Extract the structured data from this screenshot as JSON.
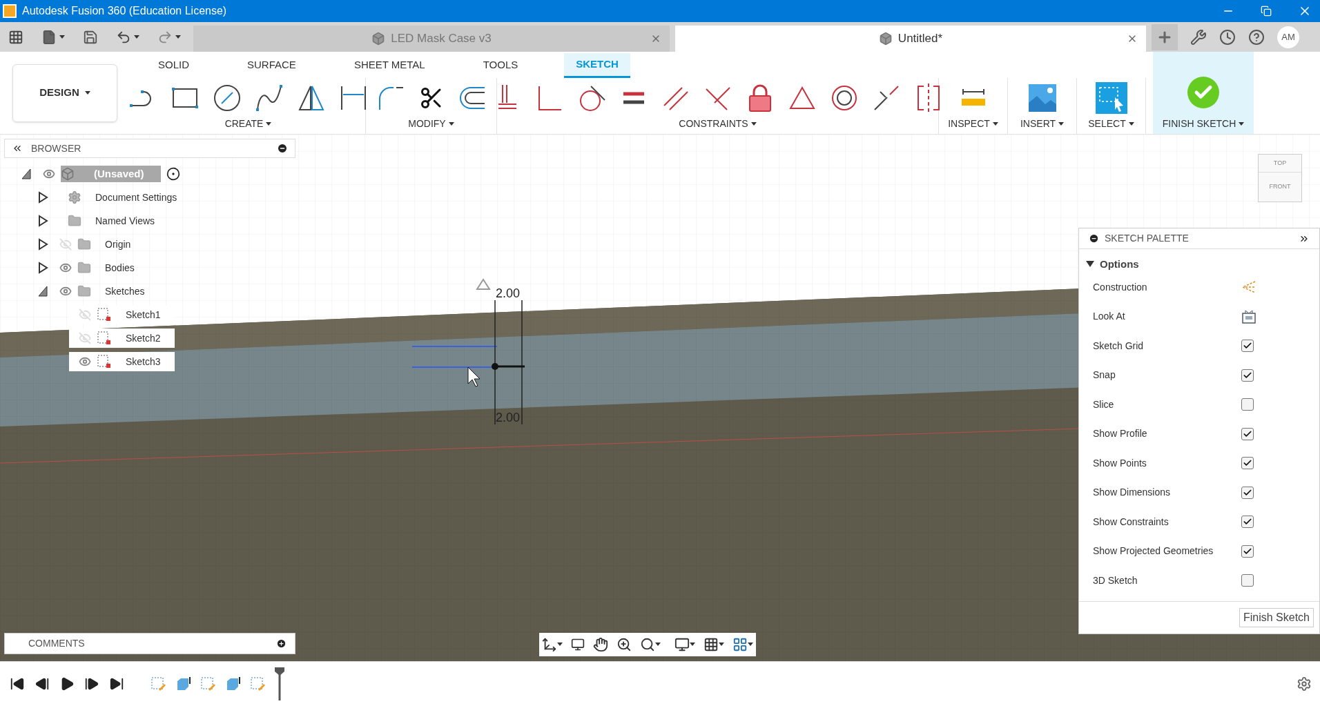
{
  "window": {
    "title": "Autodesk Fusion 360 (Education License)"
  },
  "document_tabs": [
    {
      "label": "LED Mask Case v3",
      "selected": false
    },
    {
      "label": "Untitled*",
      "selected": true
    }
  ],
  "user": {
    "initials": "AM"
  },
  "workspace": {
    "label": "DESIGN"
  },
  "toolbar_tabs": [
    {
      "label": "SOLID",
      "selected": false
    },
    {
      "label": "SURFACE",
      "selected": false
    },
    {
      "label": "SHEET METAL",
      "selected": false
    },
    {
      "label": "TOOLS",
      "selected": false
    },
    {
      "label": "SKETCH",
      "selected": true
    }
  ],
  "toolbar_groups": [
    {
      "label": "CREATE"
    },
    {
      "label": "MODIFY"
    },
    {
      "label": "CONSTRAINTS"
    },
    {
      "label": "INSPECT"
    },
    {
      "label": "INSERT"
    },
    {
      "label": "SELECT"
    }
  ],
  "finish_sketch": {
    "label": "FINISH SKETCH"
  },
  "browser": {
    "title": "BROWSER",
    "tree": [
      {
        "label": "(Unsaved)",
        "kind": "component",
        "visible": true,
        "selected": true,
        "expanded": true,
        "children": [
          {
            "label": "Document Settings",
            "kind": "gear",
            "selected": false,
            "expanded": false
          },
          {
            "label": "Named Views",
            "kind": "folder",
            "selected": false,
            "expanded": false
          },
          {
            "label": "Origin",
            "kind": "folder",
            "visible": false,
            "selected": false,
            "expanded": false
          },
          {
            "label": "Bodies",
            "kind": "folder",
            "visible": true,
            "selected": false,
            "expanded": false
          },
          {
            "label": "Sketches",
            "kind": "folder",
            "visible": true,
            "selected": false,
            "expanded": true,
            "children": [
              {
                "label": "Sketch1",
                "kind": "sketch",
                "visible": false,
                "selected": false
              },
              {
                "label": "Sketch2",
                "kind": "sketch",
                "visible": false,
                "selected": false
              },
              {
                "label": "Sketch3",
                "kind": "sketch",
                "visible": true,
                "selected": false
              }
            ]
          }
        ]
      }
    ]
  },
  "view_cube": {
    "faces": [
      "TOP",
      "FRONT"
    ]
  },
  "sketch_dimensions": [
    "2.00",
    "2.00"
  ],
  "sketch_palette": {
    "title": "SKETCH PALETTE",
    "section": {
      "label": "Options",
      "expanded": true
    },
    "options": [
      {
        "label": "Construction",
        "kind": "construction"
      },
      {
        "label": "Look At",
        "kind": "lookat"
      },
      {
        "label": "Sketch Grid",
        "kind": "checkbox",
        "checked": true
      },
      {
        "label": "Snap",
        "kind": "checkbox",
        "checked": true
      },
      {
        "label": "Slice",
        "kind": "checkbox",
        "checked": false
      },
      {
        "label": "Show Profile",
        "kind": "checkbox",
        "checked": true
      },
      {
        "label": "Show Points",
        "kind": "checkbox",
        "checked": true
      },
      {
        "label": "Show Dimensions",
        "kind": "checkbox",
        "checked": true
      },
      {
        "label": "Show Constraints",
        "kind": "checkbox",
        "checked": true
      },
      {
        "label": "Show Projected Geometries",
        "kind": "checkbox",
        "checked": true
      },
      {
        "label": "3D Sketch",
        "kind": "checkbox",
        "checked": false
      }
    ],
    "button": "Finish Sketch"
  },
  "comments": {
    "title": "COMMENTS"
  }
}
